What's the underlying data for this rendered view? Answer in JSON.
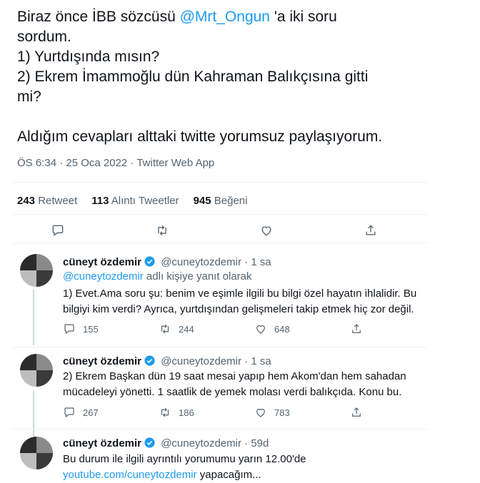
{
  "tweet": {
    "line1_pre": "Biraz önce İBB sözcüsü ",
    "line1_mention": "@Mrt_Ongun",
    "line1_post": " 'a iki soru",
    "line2": "sordum.",
    "line3": "1) Yurtdışında mısın?",
    "line4": "2) Ekrem İmammoğlu dün Kahraman Balıkçısına gitti",
    "line5": "mi?",
    "line6": "Aldığım cevapları alttaki twitte yorumsuz paylaşıyorum.",
    "time": "ÖS 6:34 · 25 Oca 2022 · Twitter Web App",
    "stats": {
      "retweet_count": "243",
      "retweet_label": "Retweet",
      "quote_count": "113",
      "quote_label": "Alıntı Tweetler",
      "like_count": "945",
      "like_label": "Beğeni"
    }
  },
  "replies": [
    {
      "name": "cüneyt özdemir",
      "handle": "@cuneytozdemir",
      "time": "· 1 sa",
      "reply_to_handle": "@cuneytozdemir",
      "reply_to_text": " adlı kişiye yanıt olarak",
      "text": "1) Evet.Ama soru şu: benim ve eşimle ilgili bu bilgi özel hayatın ihlalidir. Bu bilgiyi kim verdi? Ayrıca, yurtdışından gelişmeleri takip etmek hiç zor değil.",
      "replies": "155",
      "retweets": "244",
      "likes": "648"
    },
    {
      "name": "cüneyt özdemir",
      "handle": "@cuneytozdemir",
      "time": "· 1 sa",
      "text": "2) Ekrem Başkan dün 19 saat mesai yapıp hem Akom'dan hem sahadan mücadeleyi yönetti. 1 saatlik de yemek molası verdi balıkçıda. Konu bu.",
      "replies": "267",
      "retweets": "186",
      "likes": "783"
    },
    {
      "name": "cüneyt özdemir",
      "handle": "@cuneytozdemir",
      "time": "· 59d",
      "text_line1": "Bu durum ile ilgili ayrıntılı yorumumu yarın 12.00'de",
      "link": "youtube.com/cuneytozdemir",
      "text_after_link": " yapacağım..."
    }
  ],
  "colors": {
    "accent": "#1d9bf0",
    "muted": "#536471",
    "text": "#0f1419",
    "divider": "#eff3f4"
  }
}
